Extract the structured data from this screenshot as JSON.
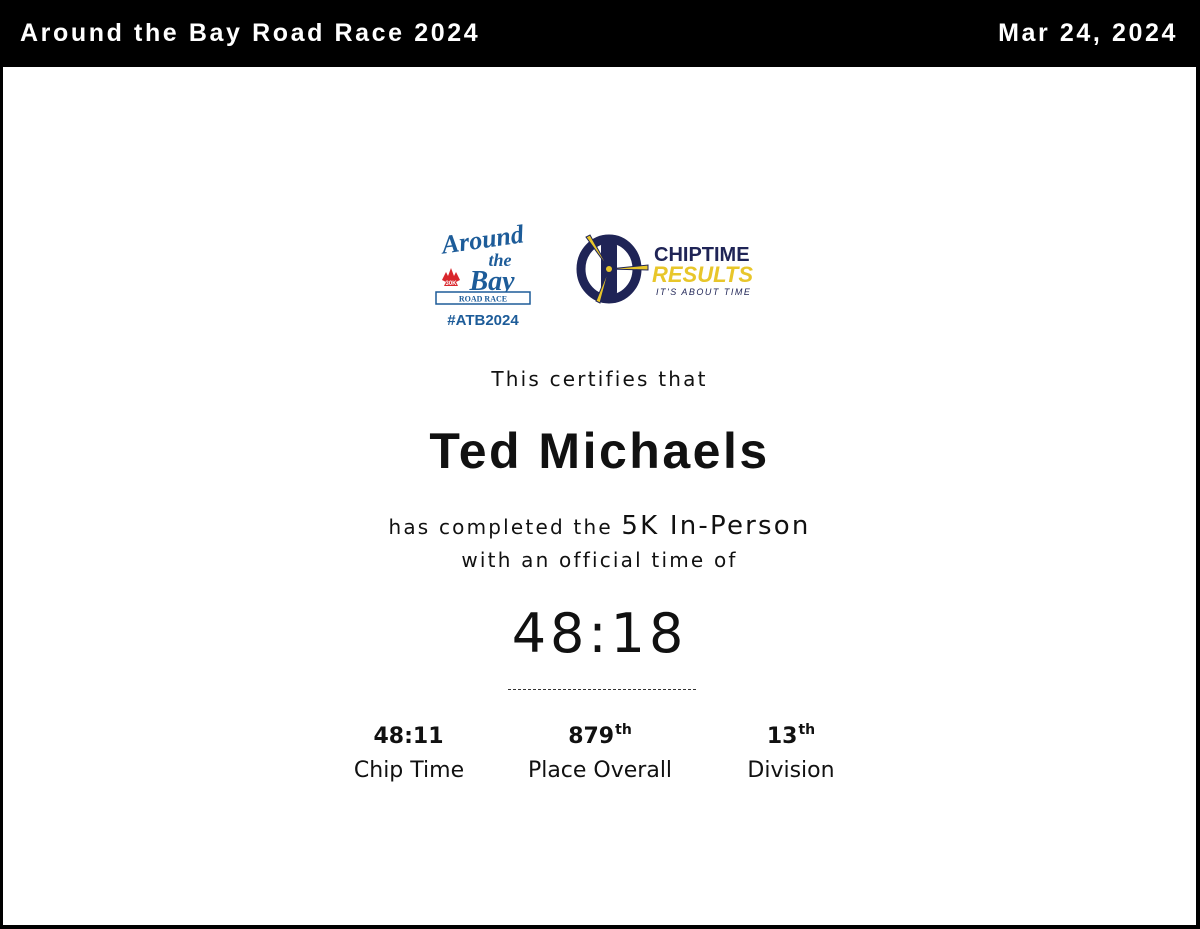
{
  "header": {
    "title": "Around the Bay Road Race 2024",
    "date": "Mar 24, 2024"
  },
  "logos": {
    "atb": {
      "line1": "Around",
      "line2": "the",
      "line3": "Bay",
      "ribbon": "ROAD RACE",
      "badge": "30K",
      "hashtag": "#ATB2024",
      "color_primary": "#1d5c99",
      "color_badge": "#d9262c"
    },
    "chiptime": {
      "word1": "CHIPTIME",
      "word2": "RESULTS",
      "tagline": "IT'S ABOUT TIME",
      "color_navy": "#1f2456",
      "color_yellow": "#e8c62a"
    }
  },
  "certificate": {
    "intro": "This certifies that",
    "participant_name": "Ted Michaels",
    "completed_prefix": "has completed the",
    "event": "5K In-Person",
    "official_time_label": "with an official time of",
    "official_time": "48:18"
  },
  "stats": [
    {
      "value": "48:11",
      "suffix": "",
      "label": "Chip Time"
    },
    {
      "value": "879",
      "suffix": "th",
      "label": "Place Overall"
    },
    {
      "value": "13",
      "suffix": "th",
      "label": "Division"
    }
  ]
}
